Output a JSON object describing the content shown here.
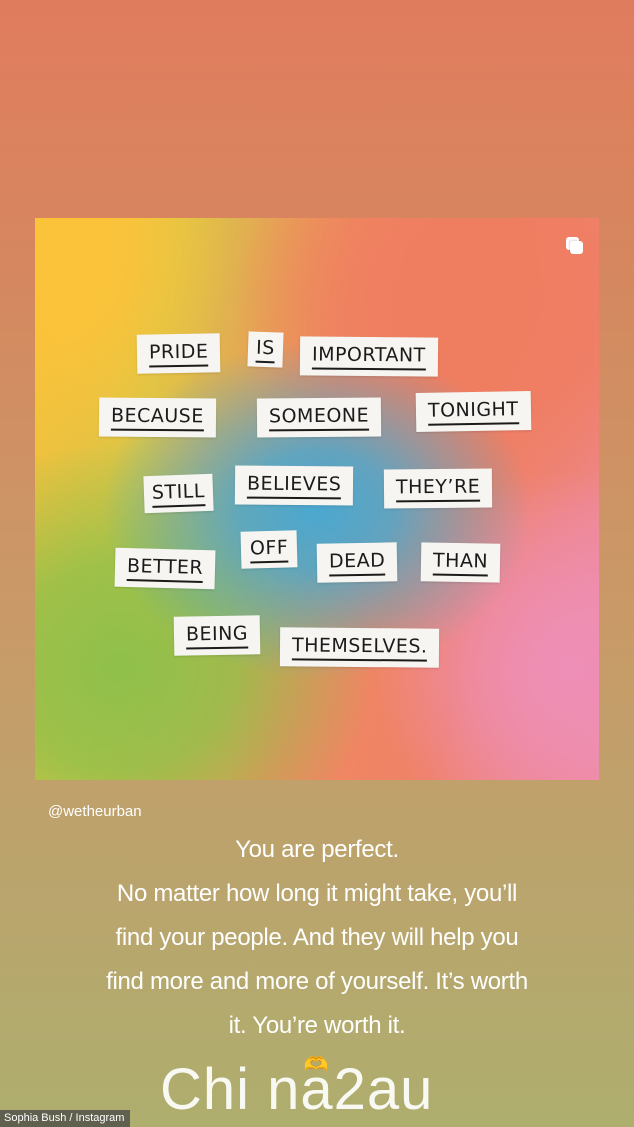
{
  "post": {
    "handle": "@wetheurban",
    "icon": "multiple-images-icon",
    "words": [
      {
        "text": "PRIDE"
      },
      {
        "text": "IS"
      },
      {
        "text": "IMPORTANT"
      },
      {
        "text": "BECAUSE"
      },
      {
        "text": "SOMEONE"
      },
      {
        "text": "TONIGHT"
      },
      {
        "text": "STILL"
      },
      {
        "text": "BELIEVES"
      },
      {
        "text": "THEY’RE"
      },
      {
        "text": "BETTER"
      },
      {
        "text": "OFF"
      },
      {
        "text": "DEAD"
      },
      {
        "text": "THAN"
      },
      {
        "text": "BEING"
      },
      {
        "text": "THEMSELVES."
      }
    ]
  },
  "caption": {
    "lines": [
      "You are perfect.",
      "No matter how long it might take, you’ll",
      "find your people. And they will help you",
      "find more and more of yourself. It’s worth",
      "it. You’re worth it."
    ],
    "emoji": "🫶"
  },
  "credit": "Sophia Bush / Instagram",
  "watermark": "Chi na2au",
  "colors": {
    "background_top": "#e07c5e",
    "background_bottom": "#aeae6e",
    "card_yellow": "#fbc33a",
    "card_blue": "#4aa8cf",
    "card_green": "#8fc04a",
    "card_pink": "#ee8fb8",
    "card_coral": "#ef7d60",
    "paper": "#f6f5f1"
  }
}
